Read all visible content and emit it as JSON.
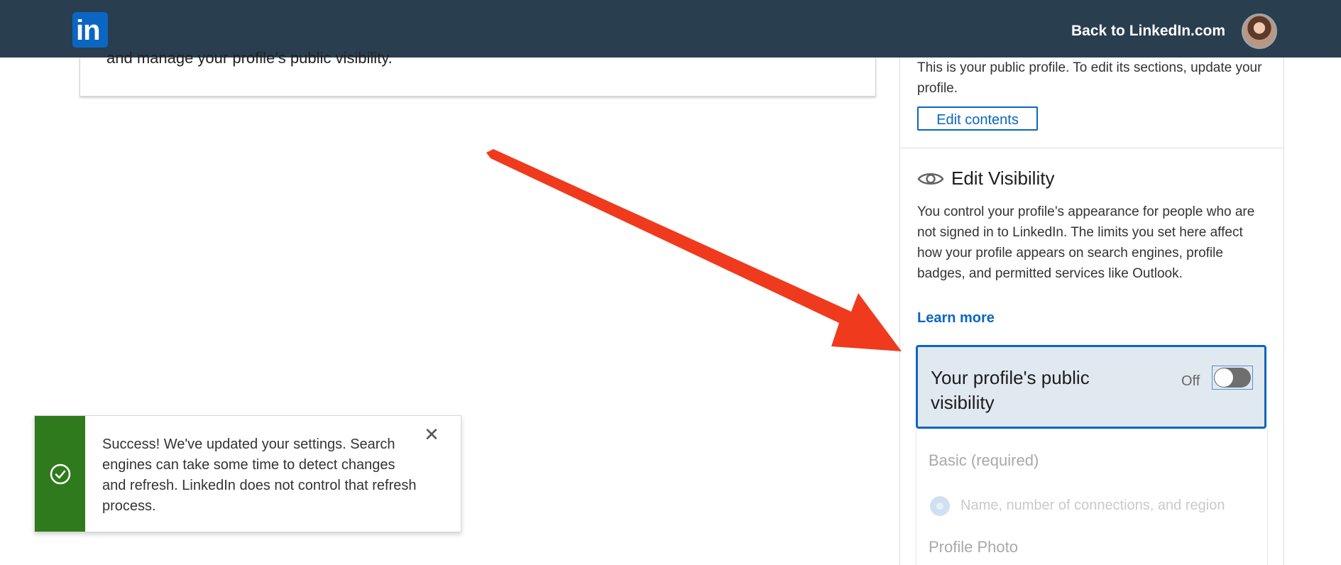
{
  "header": {
    "logo_text": "in",
    "back_link": "Back to LinkedIn.com"
  },
  "main": {
    "card_text": "and manage your profile’s public visibility."
  },
  "sidebar": {
    "public_profile_desc": "This is your public profile. To edit its sections, update your profile.",
    "edit_contents_label": "Edit contents",
    "visibility": {
      "title": "Edit Visibility",
      "description": "You control your profile’s appearance for people who are not signed in to LinkedIn. The limits you set here affect how your profile appears on search engines, profile badges, and permitted services like Outlook.",
      "learn_more": "Learn more",
      "toggle_label": "Your profile's public visibility",
      "toggle_state": "Off",
      "basic_label": "Basic (required)",
      "basic_option": "Name, number of connections, and region",
      "photo_label": "Profile Photo"
    }
  },
  "toast": {
    "message": "Success! We've updated your settings. Search engines can take some time to detect changes and refresh. LinkedIn does not control that refresh process.",
    "close_symbol": "✕"
  },
  "colors": {
    "topbar": "#293e4f",
    "brand": "#0a66c2",
    "success": "#2f7a1c",
    "annotation_arrow": "#f03a1e"
  }
}
